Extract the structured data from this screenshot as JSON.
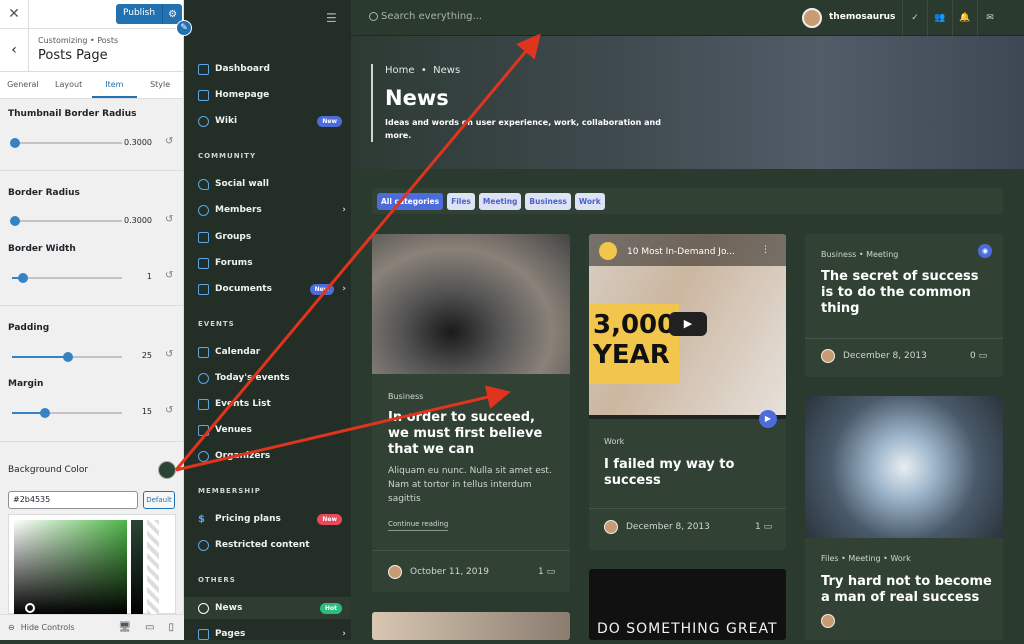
{
  "customizer": {
    "publish": "Publish",
    "crumb": "Customizing • Posts",
    "title": "Posts Page",
    "tabs": [
      "General",
      "Layout",
      "Item",
      "Style"
    ],
    "thumb_radius_label": "Thumbnail Border Radius",
    "thumb_radius_value": "0.3000",
    "border_radius_label": "Border Radius",
    "border_radius_value": "0.3000",
    "border_width_label": "Border Width",
    "border_width_value": "1",
    "padding_label": "Padding",
    "padding_value": "25",
    "margin_label": "Margin",
    "margin_value": "15",
    "bg_label": "Background Color",
    "hex": "#2b4535",
    "default_btn": "Default",
    "hide_controls": "Hide Controls"
  },
  "sidebar": {
    "items": [
      {
        "label": "Dashboard"
      },
      {
        "label": "Homepage"
      },
      {
        "label": "Wiki",
        "badge": "New"
      },
      {
        "label": "Social wall"
      },
      {
        "label": "Members"
      },
      {
        "label": "Groups"
      },
      {
        "label": "Forums"
      },
      {
        "label": "Documents",
        "badge": "New"
      },
      {
        "label": "Calendar"
      },
      {
        "label": "Today's events"
      },
      {
        "label": "Events List"
      },
      {
        "label": "Venues"
      },
      {
        "label": "Organizers"
      },
      {
        "label": "Pricing plans",
        "badge": "New"
      },
      {
        "label": "Restricted content"
      },
      {
        "label": "News",
        "badge": "Hot"
      },
      {
        "label": "Pages"
      }
    ],
    "headers": [
      "COMMUNITY",
      "EVENTS",
      "MEMBERSHIP",
      "OTHERS"
    ]
  },
  "topbar": {
    "search_placeholder": "Search everything...",
    "user": "themosaurus"
  },
  "hero": {
    "crumb_home": "Home",
    "crumb_sep": "•",
    "crumb_current": "News",
    "title": "News",
    "desc": "Ideas and words on user experience, work, collaboration and more."
  },
  "filters": [
    "All categories",
    "Files",
    "Meeting",
    "Business",
    "Work"
  ],
  "cards": {
    "c1": {
      "cat": "Business",
      "title": "In order to succeed, we must first believe that we can",
      "excerpt": "Aliquam eu nunc. Nulla sit amet est. Nam at tortor in tellus interdum sagittis",
      "cont": "Continue reading",
      "date": "October 11, 2019",
      "comments": "1"
    },
    "c2": {
      "video_title": "10 Most In-Demand Jo...",
      "video_text": "3,000 YEAR",
      "cat": "Work",
      "title": "I failed my way to success",
      "date": "December 8, 2013",
      "comments": "1"
    },
    "c3": {
      "cat1": "Business",
      "cat2": "Meeting",
      "title": "The secret of success is to do the common thing",
      "date": "December 8, 2013",
      "comments": "0"
    },
    "c4": {
      "cat1": "Files",
      "cat2": "Meeting",
      "cat3": "Work",
      "title": "Try hard not to become a man of real success"
    },
    "c5": {
      "neon": "DO SOMETHING GREAT"
    }
  },
  "colors": {
    "bg": "#2b3a2e",
    "card": "#314235",
    "accent": "#4d6cdb",
    "arrow": "#e0341e"
  }
}
